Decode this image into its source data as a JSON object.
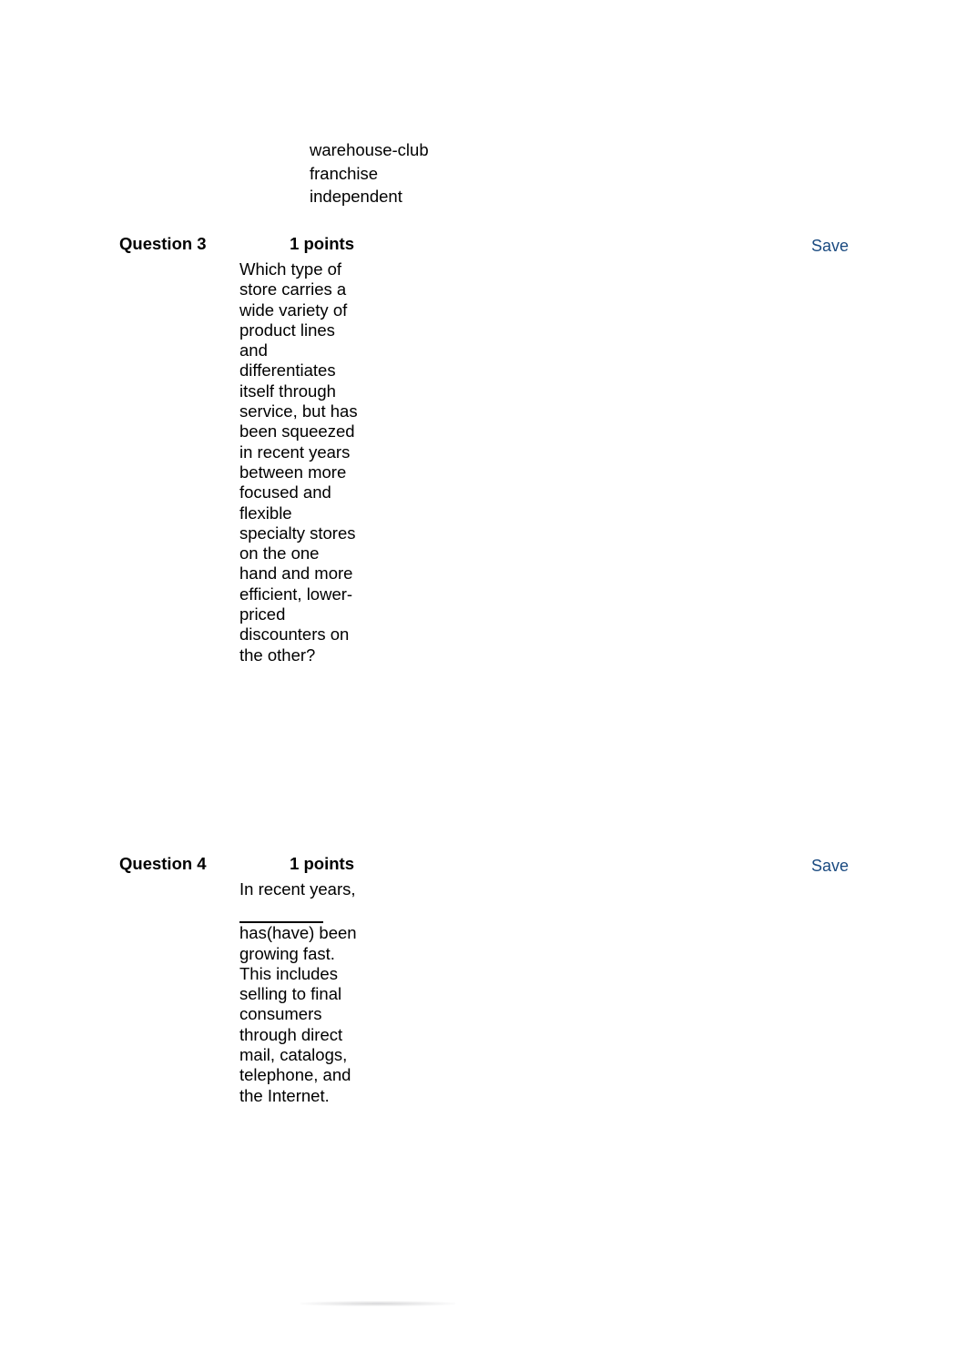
{
  "page": {
    "background_color": "#ffffff",
    "text_color": "#000000",
    "link_color": "#1a4a80"
  },
  "carryover_options": {
    "name": "previous-question-answer-options",
    "items": [
      "warehouse-club",
      "franchise",
      "independent"
    ]
  },
  "questions": [
    {
      "id": "question-3",
      "title": "Question 3",
      "points": "1 points",
      "save_label": "Save",
      "body": "Which type of store carries a wide variety of product lines and differentiates itself through service, but has been squeezed in recent years between more focused and flexible specialty stores on the one hand and more efficient, lower-priced discounters on the other?"
    },
    {
      "id": "question-4",
      "title": "Question 4",
      "points": "1 points",
      "save_label": "Save",
      "body_before_blank": "In recent years,",
      "body_after_blank": "has(have) been growing fast. This includes selling to final consumers through direct mail, catalogs, telephone, and the Internet."
    }
  ]
}
